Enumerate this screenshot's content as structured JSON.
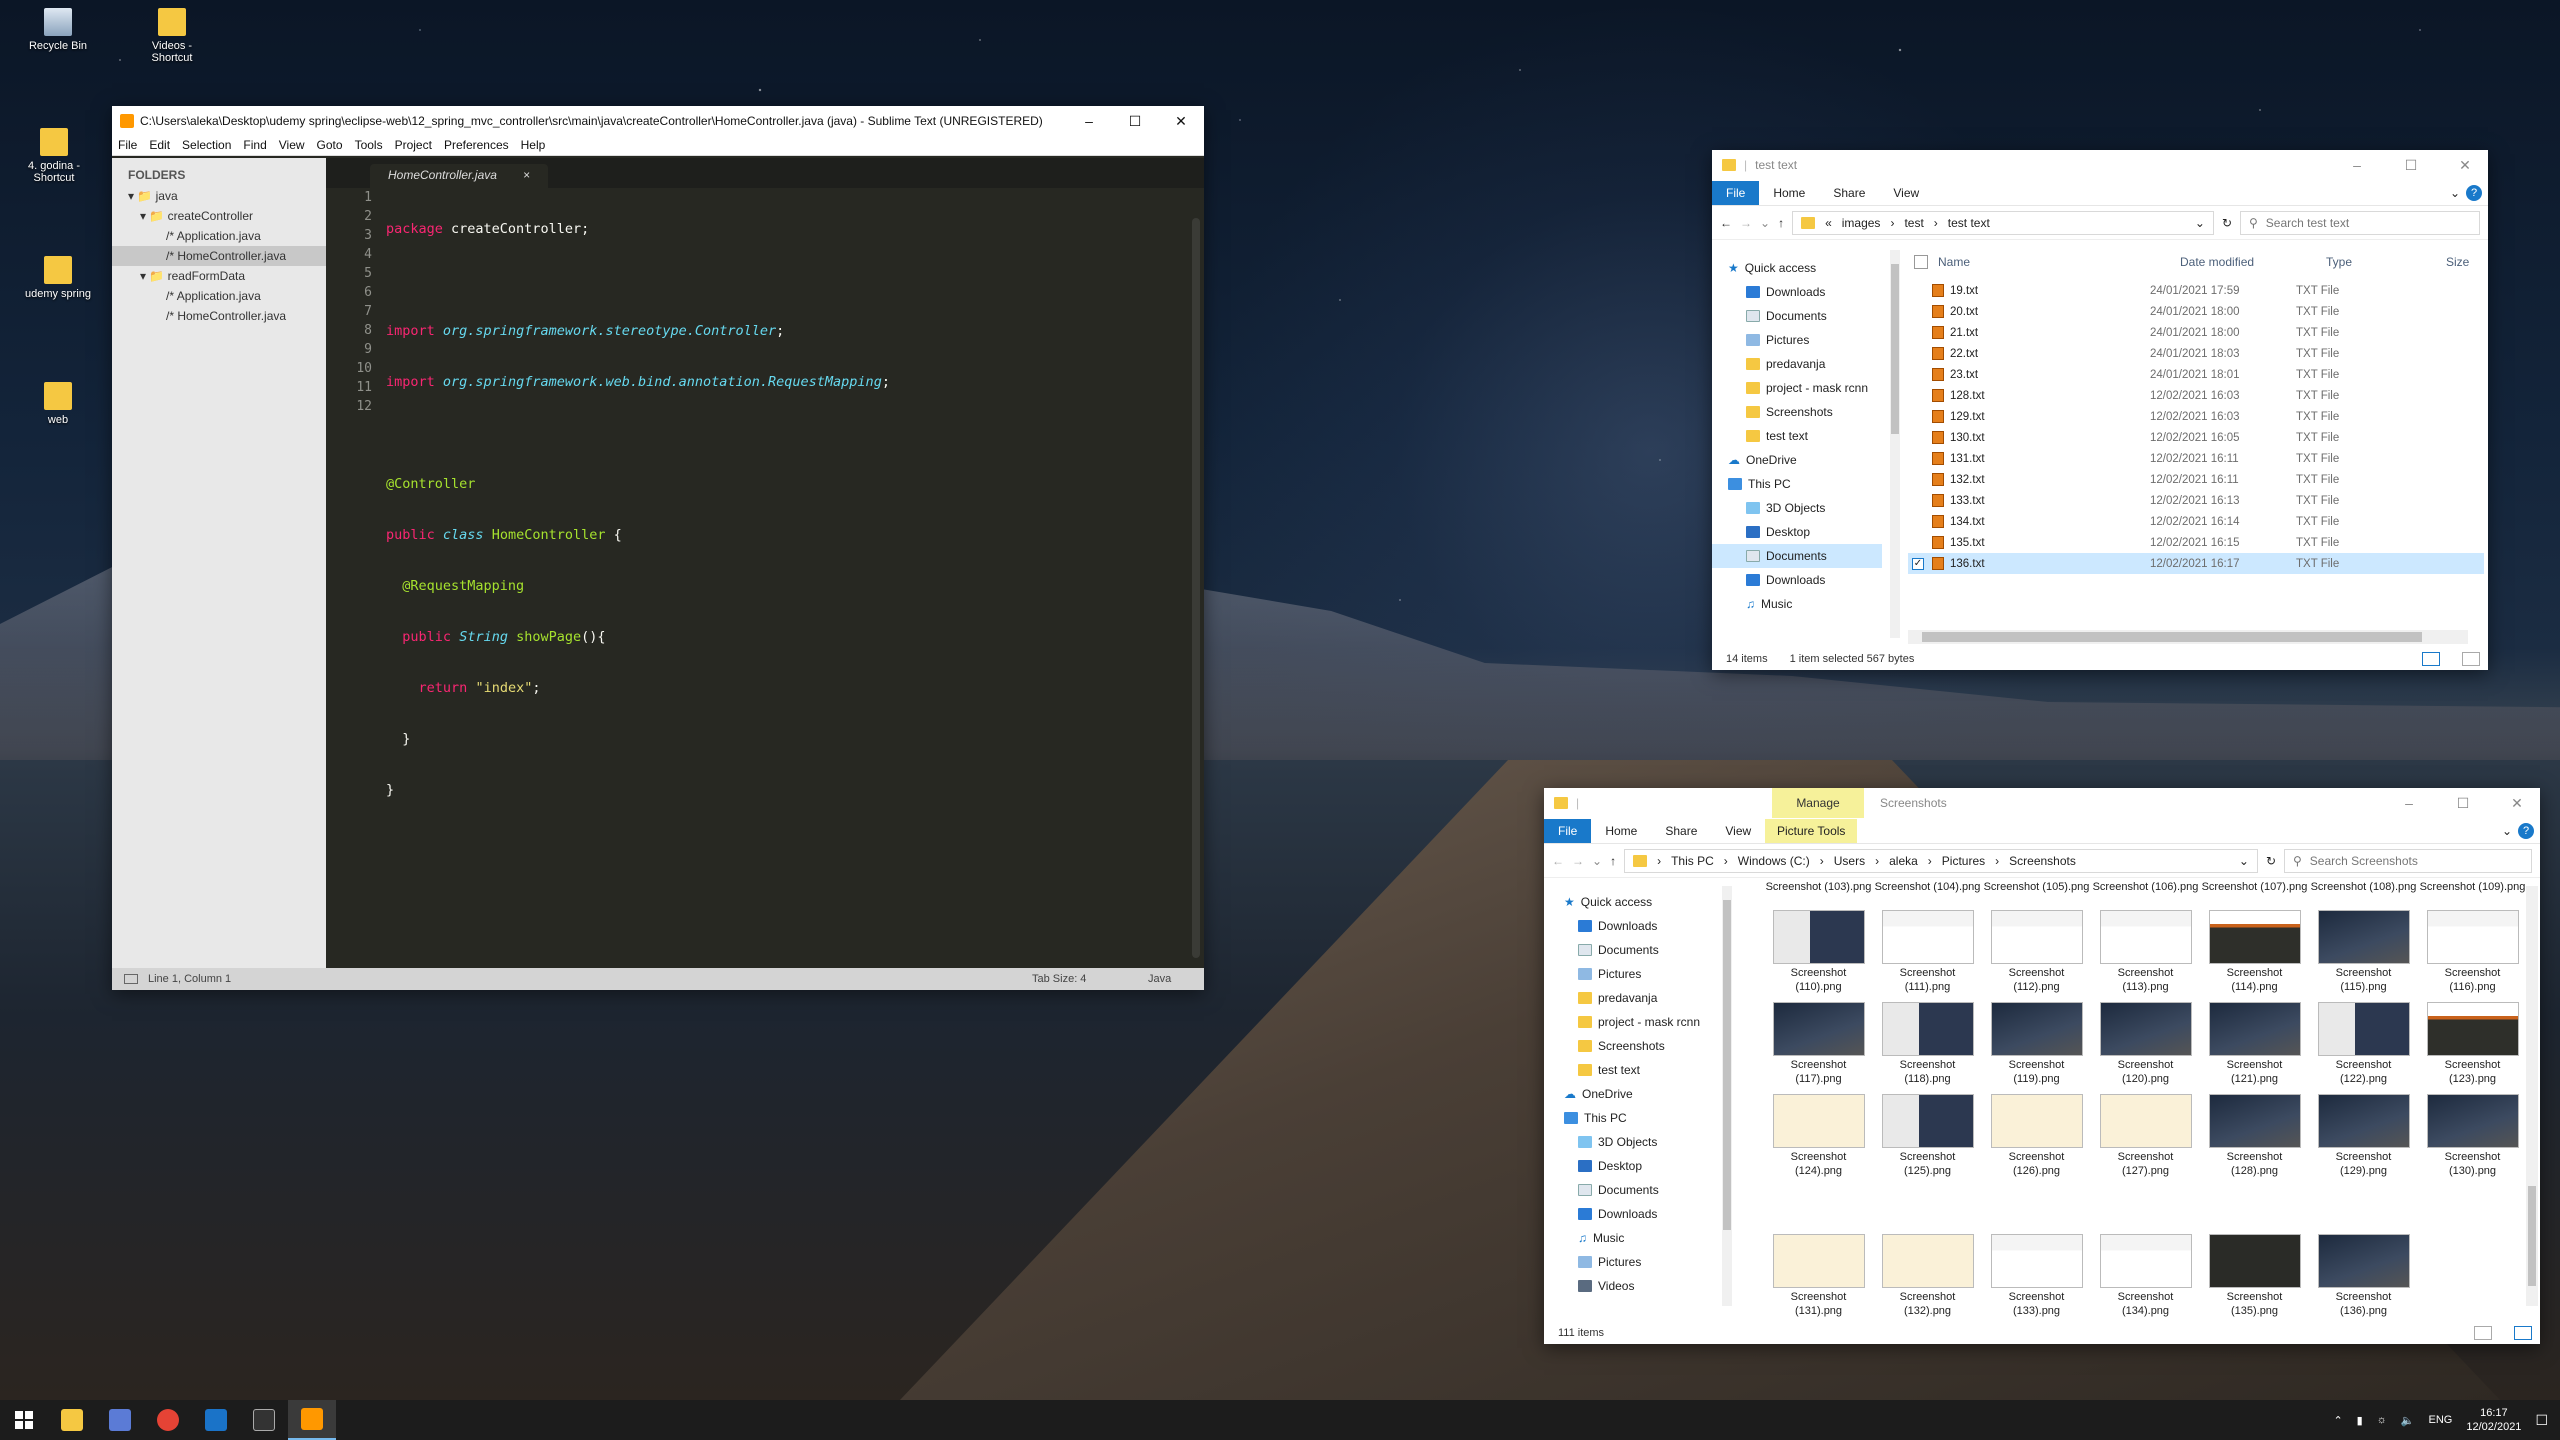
{
  "desktop": {
    "icons": [
      {
        "label": "Recycle Bin"
      },
      {
        "label": "Videos - Shortcut"
      },
      {
        "label": "4. godina - Shortcut"
      },
      {
        "label": "udemy spring"
      },
      {
        "label": "web"
      }
    ]
  },
  "sublime": {
    "title": "C:\\Users\\aleka\\Desktop\\udemy spring\\eclipse-web\\12_spring_mvc_controller\\src\\main\\java\\createController\\HomeController.java (java) - Sublime Text (UNREGISTERED)",
    "menu": [
      "File",
      "Edit",
      "Selection",
      "Find",
      "View",
      "Goto",
      "Tools",
      "Project",
      "Preferences",
      "Help"
    ],
    "folders_header": "FOLDERS",
    "tree": [
      {
        "label": "java",
        "depth": 0,
        "type": "folder"
      },
      {
        "label": "createController",
        "depth": 1,
        "type": "folder"
      },
      {
        "label": "Application.java",
        "depth": 2,
        "type": "file"
      },
      {
        "label": "HomeController.java",
        "depth": 2,
        "type": "file",
        "selected": true
      },
      {
        "label": "readFormData",
        "depth": 1,
        "type": "folder"
      },
      {
        "label": "Application.java",
        "depth": 2,
        "type": "file"
      },
      {
        "label": "HomeController.java",
        "depth": 2,
        "type": "file"
      }
    ],
    "tab": "HomeController.java",
    "tab_close": "×",
    "line_numbers": [
      "1",
      "2",
      "3",
      "4",
      "5",
      "6",
      "7",
      "8",
      "9",
      "10",
      "11",
      "12"
    ],
    "code": {
      "l1a": "package",
      "l1b": " createController;",
      "l3a": "import",
      "l3b": "org.springframework.stereotype.Controller",
      "l4a": "import",
      "l4b": "org.springframework.web.bind.annotation.RequestMapping",
      "l6": "@Controller",
      "l7a": "public",
      "l7b": "class",
      "l7c": "HomeController",
      "l8": "@RequestMapping",
      "l9a": "public",
      "l9b": "String",
      "l9c": "showPage",
      "l10a": "return",
      "l10b": "\"index\""
    },
    "status": {
      "position": "Line 1, Column 1",
      "tabsize": "Tab Size: 4",
      "syntax": "Java"
    }
  },
  "explorer1": {
    "title": "test text",
    "tabs": [
      "File",
      "Home",
      "Share",
      "View"
    ],
    "path": [
      "images",
      "test",
      "test text"
    ],
    "search_placeholder": "Search test text",
    "nav": [
      {
        "label": "Quick access",
        "kind": "quick"
      },
      {
        "label": "Downloads",
        "kind": "dl"
      },
      {
        "label": "Documents",
        "kind": "doc"
      },
      {
        "label": "Pictures",
        "kind": "pic"
      },
      {
        "label": "predavanja",
        "kind": "folder"
      },
      {
        "label": "project - mask rcnn",
        "kind": "folder"
      },
      {
        "label": "Screenshots",
        "kind": "folder"
      },
      {
        "label": "test text",
        "kind": "folder"
      },
      {
        "label": "OneDrive",
        "kind": "cloud"
      },
      {
        "label": "This PC",
        "kind": "pc"
      },
      {
        "label": "3D Objects",
        "kind": "sub"
      },
      {
        "label": "Desktop",
        "kind": "sub"
      },
      {
        "label": "Documents",
        "kind": "sub",
        "selected": true
      },
      {
        "label": "Downloads",
        "kind": "sub"
      },
      {
        "label": "Music",
        "kind": "sub"
      }
    ],
    "columns": [
      "Name",
      "Date modified",
      "Type",
      "Size"
    ],
    "files": [
      {
        "name": "19.txt",
        "date": "24/01/2021 17:59",
        "type": "TXT File"
      },
      {
        "name": "20.txt",
        "date": "24/01/2021 18:00",
        "type": "TXT File"
      },
      {
        "name": "21.txt",
        "date": "24/01/2021 18:00",
        "type": "TXT File"
      },
      {
        "name": "22.txt",
        "date": "24/01/2021 18:03",
        "type": "TXT File"
      },
      {
        "name": "23.txt",
        "date": "24/01/2021 18:01",
        "type": "TXT File"
      },
      {
        "name": "128.txt",
        "date": "12/02/2021 16:03",
        "type": "TXT File"
      },
      {
        "name": "129.txt",
        "date": "12/02/2021 16:03",
        "type": "TXT File"
      },
      {
        "name": "130.txt",
        "date": "12/02/2021 16:05",
        "type": "TXT File"
      },
      {
        "name": "131.txt",
        "date": "12/02/2021 16:11",
        "type": "TXT File"
      },
      {
        "name": "132.txt",
        "date": "12/02/2021 16:11",
        "type": "TXT File"
      },
      {
        "name": "133.txt",
        "date": "12/02/2021 16:13",
        "type": "TXT File"
      },
      {
        "name": "134.txt",
        "date": "12/02/2021 16:14",
        "type": "TXT File"
      },
      {
        "name": "135.txt",
        "date": "12/02/2021 16:15",
        "type": "TXT File"
      },
      {
        "name": "136.txt",
        "date": "12/02/2021 16:17",
        "type": "TXT File",
        "selected": true
      }
    ],
    "status": {
      "count": "14 items",
      "selected": "1 item selected  567 bytes"
    }
  },
  "explorer2": {
    "title": "Screenshots",
    "manage": "Manage",
    "picture_tools": "Picture Tools",
    "tabs": [
      "File",
      "Home",
      "Share",
      "View"
    ],
    "path": [
      "This PC",
      "Windows (C:)",
      "Users",
      "aleka",
      "Pictures",
      "Screenshots"
    ],
    "search_placeholder": "Search Screenshots",
    "nav": [
      {
        "label": "Quick access",
        "kind": "quick"
      },
      {
        "label": "Downloads",
        "kind": "dl"
      },
      {
        "label": "Documents",
        "kind": "doc"
      },
      {
        "label": "Pictures",
        "kind": "pic"
      },
      {
        "label": "predavanja",
        "kind": "folder"
      },
      {
        "label": "project - mask rcnn",
        "kind": "folder"
      },
      {
        "label": "Screenshots",
        "kind": "folder"
      },
      {
        "label": "test text",
        "kind": "folder"
      },
      {
        "label": "OneDrive",
        "kind": "cloud"
      },
      {
        "label": "This PC",
        "kind": "pc"
      },
      {
        "label": "3D Objects",
        "kind": "sub"
      },
      {
        "label": "Desktop",
        "kind": "sub"
      },
      {
        "label": "Documents",
        "kind": "sub"
      },
      {
        "label": "Downloads",
        "kind": "sub"
      },
      {
        "label": "Music",
        "kind": "sub"
      },
      {
        "label": "Pictures",
        "kind": "sub"
      },
      {
        "label": "Videos",
        "kind": "sub"
      }
    ],
    "top_row": [
      "Screenshot (103).png",
      "Screenshot (104).png",
      "Screenshot (105).png",
      "Screenshot (106).png",
      "Screenshot (107).png",
      "Screenshot (108).png",
      "Screenshot (109).png"
    ],
    "thumbs": [
      {
        "num": "110",
        "style": "mix"
      },
      {
        "num": "111",
        "style": "light"
      },
      {
        "num": "112",
        "style": "light"
      },
      {
        "num": "113",
        "style": "light"
      },
      {
        "num": "114",
        "style": "orange"
      },
      {
        "num": "115",
        "style": "dark"
      },
      {
        "num": "116",
        "style": "light"
      },
      {
        "num": "117",
        "style": "dark"
      },
      {
        "num": "118",
        "style": "mix"
      },
      {
        "num": "119",
        "style": "dark"
      },
      {
        "num": "120",
        "style": "dark"
      },
      {
        "num": "121",
        "style": "dark"
      },
      {
        "num": "122",
        "style": "mix"
      },
      {
        "num": "123",
        "style": "orange"
      },
      {
        "num": "124",
        "style": "cream"
      },
      {
        "num": "125",
        "style": "mix"
      },
      {
        "num": "126",
        "style": "cream"
      },
      {
        "num": "127",
        "style": "cream"
      },
      {
        "num": "128",
        "style": "dark"
      },
      {
        "num": "129",
        "style": "dark"
      },
      {
        "num": "130",
        "style": "dark"
      },
      {
        "num": "131",
        "style": "cream"
      },
      {
        "num": "132",
        "style": "cream"
      },
      {
        "num": "133",
        "style": "light"
      },
      {
        "num": "134",
        "style": "light"
      },
      {
        "num": "135",
        "style": "black"
      },
      {
        "num": "136",
        "style": "dark"
      }
    ],
    "caption_prefix": "Screenshot",
    "status": {
      "count": "111 items"
    }
  },
  "taskbar": {
    "apps": [
      {
        "name": "file-explorer",
        "color": "#f5c842"
      },
      {
        "name": "onenote-like",
        "color": "#5b7bd6"
      },
      {
        "name": "chrome",
        "color": "#e54335"
      },
      {
        "name": "app-blue",
        "color": "#1a73c8"
      },
      {
        "name": "terminal",
        "color": "#333"
      },
      {
        "name": "sublime",
        "color": "#ff9800"
      }
    ],
    "lang": "ENG",
    "time": "16:17",
    "date": "12/02/2021"
  },
  "colors": {
    "accent": "#1979ca",
    "sublime_bg": "#272822",
    "selection": "#cce8ff"
  }
}
